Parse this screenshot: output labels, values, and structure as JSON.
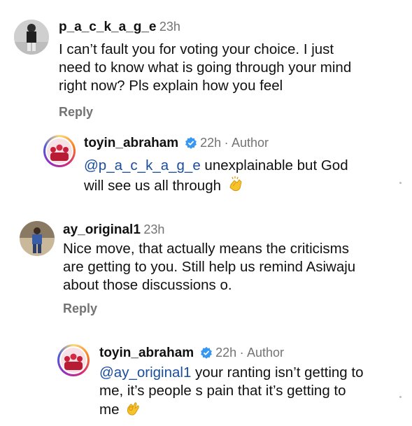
{
  "comments": [
    {
      "username": "p_a_c_k_a_g_e",
      "time": "23h",
      "text": "I can’t fault you for voting your choice. I just need to know what is going through your mind right now? Pls explain how you feel",
      "lines": [
        "I can’t fault you for voting your choice. I just",
        "need to know what is going through your mind",
        "right now? Pls explain how you feel"
      ],
      "reply_label": "Reply",
      "reply": {
        "username": "toyin_abraham",
        "time": "22h",
        "separator": "·",
        "author_label": "Author",
        "mention": "@p_a_c_k_a_g_e",
        "line1_rest": " unexplainable but God",
        "line2": "will see us all through",
        "emoji": "clapping-hands-emoji"
      }
    },
    {
      "username": "ay_original1",
      "time": "23h",
      "lines": [
        "Nice move, that actually means the criticisms",
        "are getting to you.  Still help us remind Asiwaju",
        "about those discussions o."
      ],
      "reply_label": "Reply",
      "reply": {
        "username": "toyin_abraham",
        "time": "22h",
        "separator": "·",
        "author_label": "Author",
        "mention": "@ay_original1",
        "line1_rest": " your ranting isn’t getting to",
        "line2": "me, it’s people s pain that it’s getting to",
        "line3": "me",
        "emoji": "ok-hand-emoji"
      }
    }
  ],
  "colors": {
    "mention": "#1a4d9e",
    "meta": "#737373",
    "verified": "#3897f0"
  }
}
